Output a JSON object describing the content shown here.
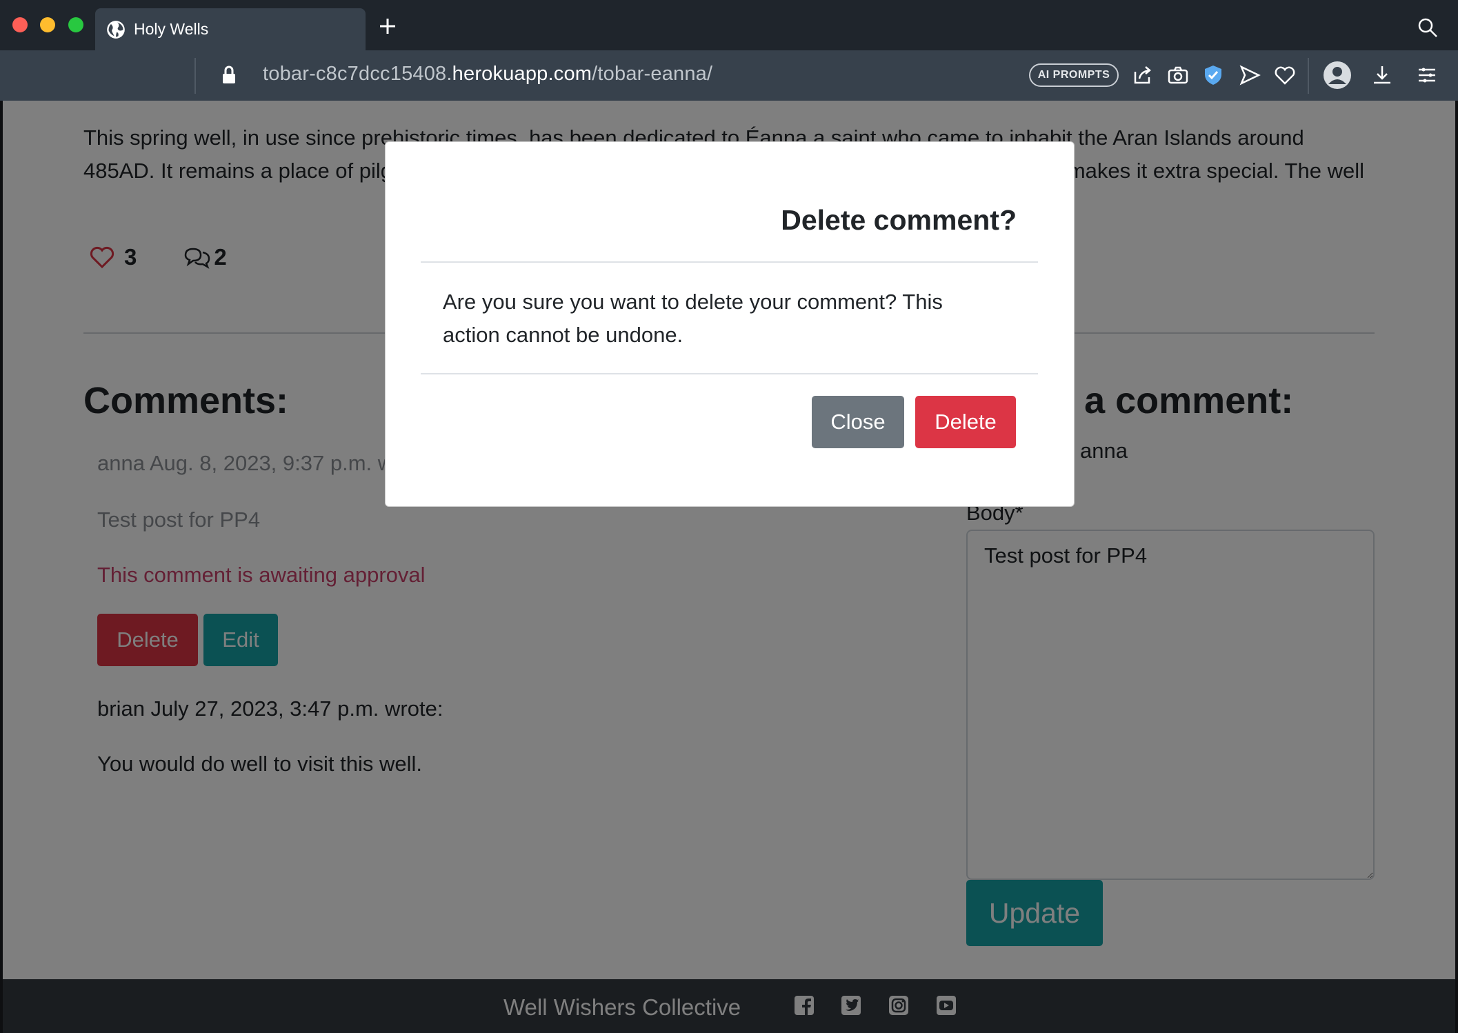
{
  "browser": {
    "tab_title": "Holy Wells",
    "url_prefix": "tobar-c8c7dcc15408.",
    "url_host": "herokuapp.com",
    "url_path": "/tobar-eanna/",
    "ai_prompts_label": "AI PROMPTS"
  },
  "post": {
    "intro": "This spring well, in use since prehistoric times, has been dedicated to Éanna a saint who came to inhabit the Aran Islands around 485AD. It remains a place of pilgrimage today and the possibility of a sighting of the elusive resident eel makes it extra special. The well",
    "likes": "3",
    "comments_count": "2"
  },
  "comments": {
    "heading": "Comments:",
    "items": [
      {
        "meta": "anna Aug. 8, 2023, 9:37 p.m. wrote:",
        "body": "Test post for PP4",
        "status": "This comment is awaiting approval",
        "delete_label": "Delete",
        "edit_label": "Edit"
      },
      {
        "meta": "brian July 27, 2023, 3:47 p.m. wrote:",
        "body": "You would do well to visit this well."
      }
    ]
  },
  "comment_form": {
    "heading": "Leave a comment:",
    "posting_as": "Posting as: anna",
    "body_label": "Body*",
    "body_value": "Test post for PP4",
    "submit_label": "Update"
  },
  "modal": {
    "title": "Delete comment?",
    "message": "Are you sure you want to delete your comment? This action cannot be undone.",
    "close_label": "Close",
    "delete_label": "Delete"
  },
  "footer": {
    "text": "Well Wishers Collective",
    "social_icons": [
      "facebook-icon",
      "twitter-icon",
      "instagram-icon",
      "youtube-icon"
    ]
  },
  "colors": {
    "danger": "#dc3545",
    "teal": "#17a2a6",
    "secondary": "#6c757d",
    "footer_bg": "#343a40",
    "heart": "#dc3545"
  }
}
